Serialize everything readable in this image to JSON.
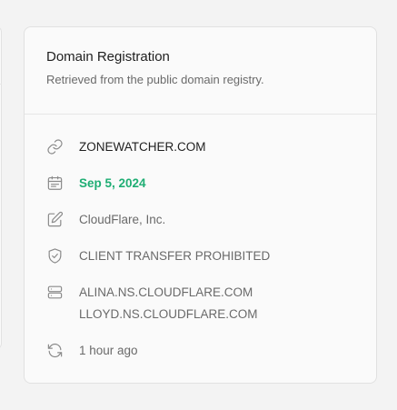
{
  "card": {
    "title": "Domain Registration",
    "subtitle": "Retrieved from the public domain registry."
  },
  "domain": {
    "name": "ZONEWATCHER.COM",
    "icon": "link-icon"
  },
  "expiry": {
    "date": "Sep 5, 2024",
    "icon": "calendar-icon",
    "color": "#1fae74"
  },
  "registrar": {
    "name": "CloudFlare, Inc.",
    "icon": "edit-icon"
  },
  "status": {
    "text": "CLIENT TRANSFER PROHIBITED",
    "icon": "shield-check-icon"
  },
  "nameservers": {
    "icon": "server-icon",
    "items": [
      "ALINA.NS.CLOUDFLARE.COM",
      "LLOYD.NS.CLOUDFLARE.COM"
    ]
  },
  "updated": {
    "text": "1 hour ago",
    "icon": "refresh-icon"
  }
}
